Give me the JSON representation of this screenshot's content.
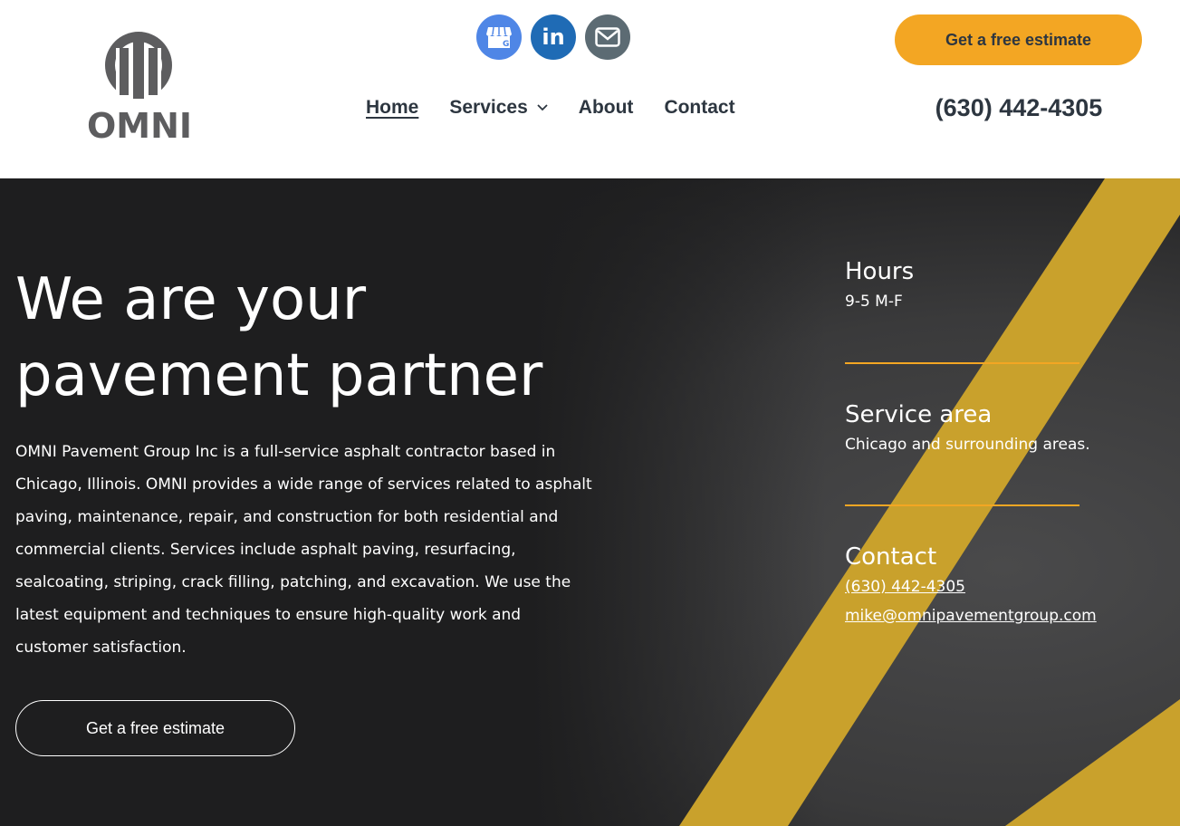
{
  "brand": {
    "name": "OMNI",
    "logo_icon": "building-columns-logo",
    "logo_color": "#5d5d5f"
  },
  "social": [
    {
      "icon": "google-business-icon",
      "color": "#4f86e6"
    },
    {
      "icon": "linkedin-icon",
      "label": "in",
      "color": "#1f6bb5"
    },
    {
      "icon": "mail-icon",
      "color": "#5c6b73"
    }
  ],
  "nav": [
    {
      "label": "Home",
      "active": true
    },
    {
      "label": "Services",
      "dropdown": true
    },
    {
      "label": "About"
    },
    {
      "label": "Contact"
    }
  ],
  "header": {
    "cta_label": "Get a free estimate",
    "phone": "(630) 442-4305"
  },
  "hero": {
    "title_line1": "We are your",
    "title_line2": "pavement partner",
    "description": "OMNI Pavement Group Inc is a full-service asphalt contractor based in Chicago, Illinois. OMNI provides a wide range of services related to asphalt paving, maintenance, repair, and construction for both residential and commercial clients.  Services include asphalt paving, resurfacing, sealcoating, striping, crack filling, patching, and excavation.  We use the latest equipment and techniques to ensure high-quality work and customer satisfaction.",
    "cta_label": "Get a free estimate"
  },
  "info": {
    "hours_title": "Hours",
    "hours_value": "9-5 M-F",
    "area_title": "Service area",
    "area_value": "Chicago and surrounding areas.",
    "contact_title": "Contact",
    "contact_phone": "(630) 442-4305",
    "contact_email": "mike@omnipavementgroup.com"
  },
  "colors": {
    "accent": "#f3a623",
    "text_dark": "#2d3640",
    "hero_bg": "#1e1e1f",
    "stripe": "#c9a12c"
  }
}
